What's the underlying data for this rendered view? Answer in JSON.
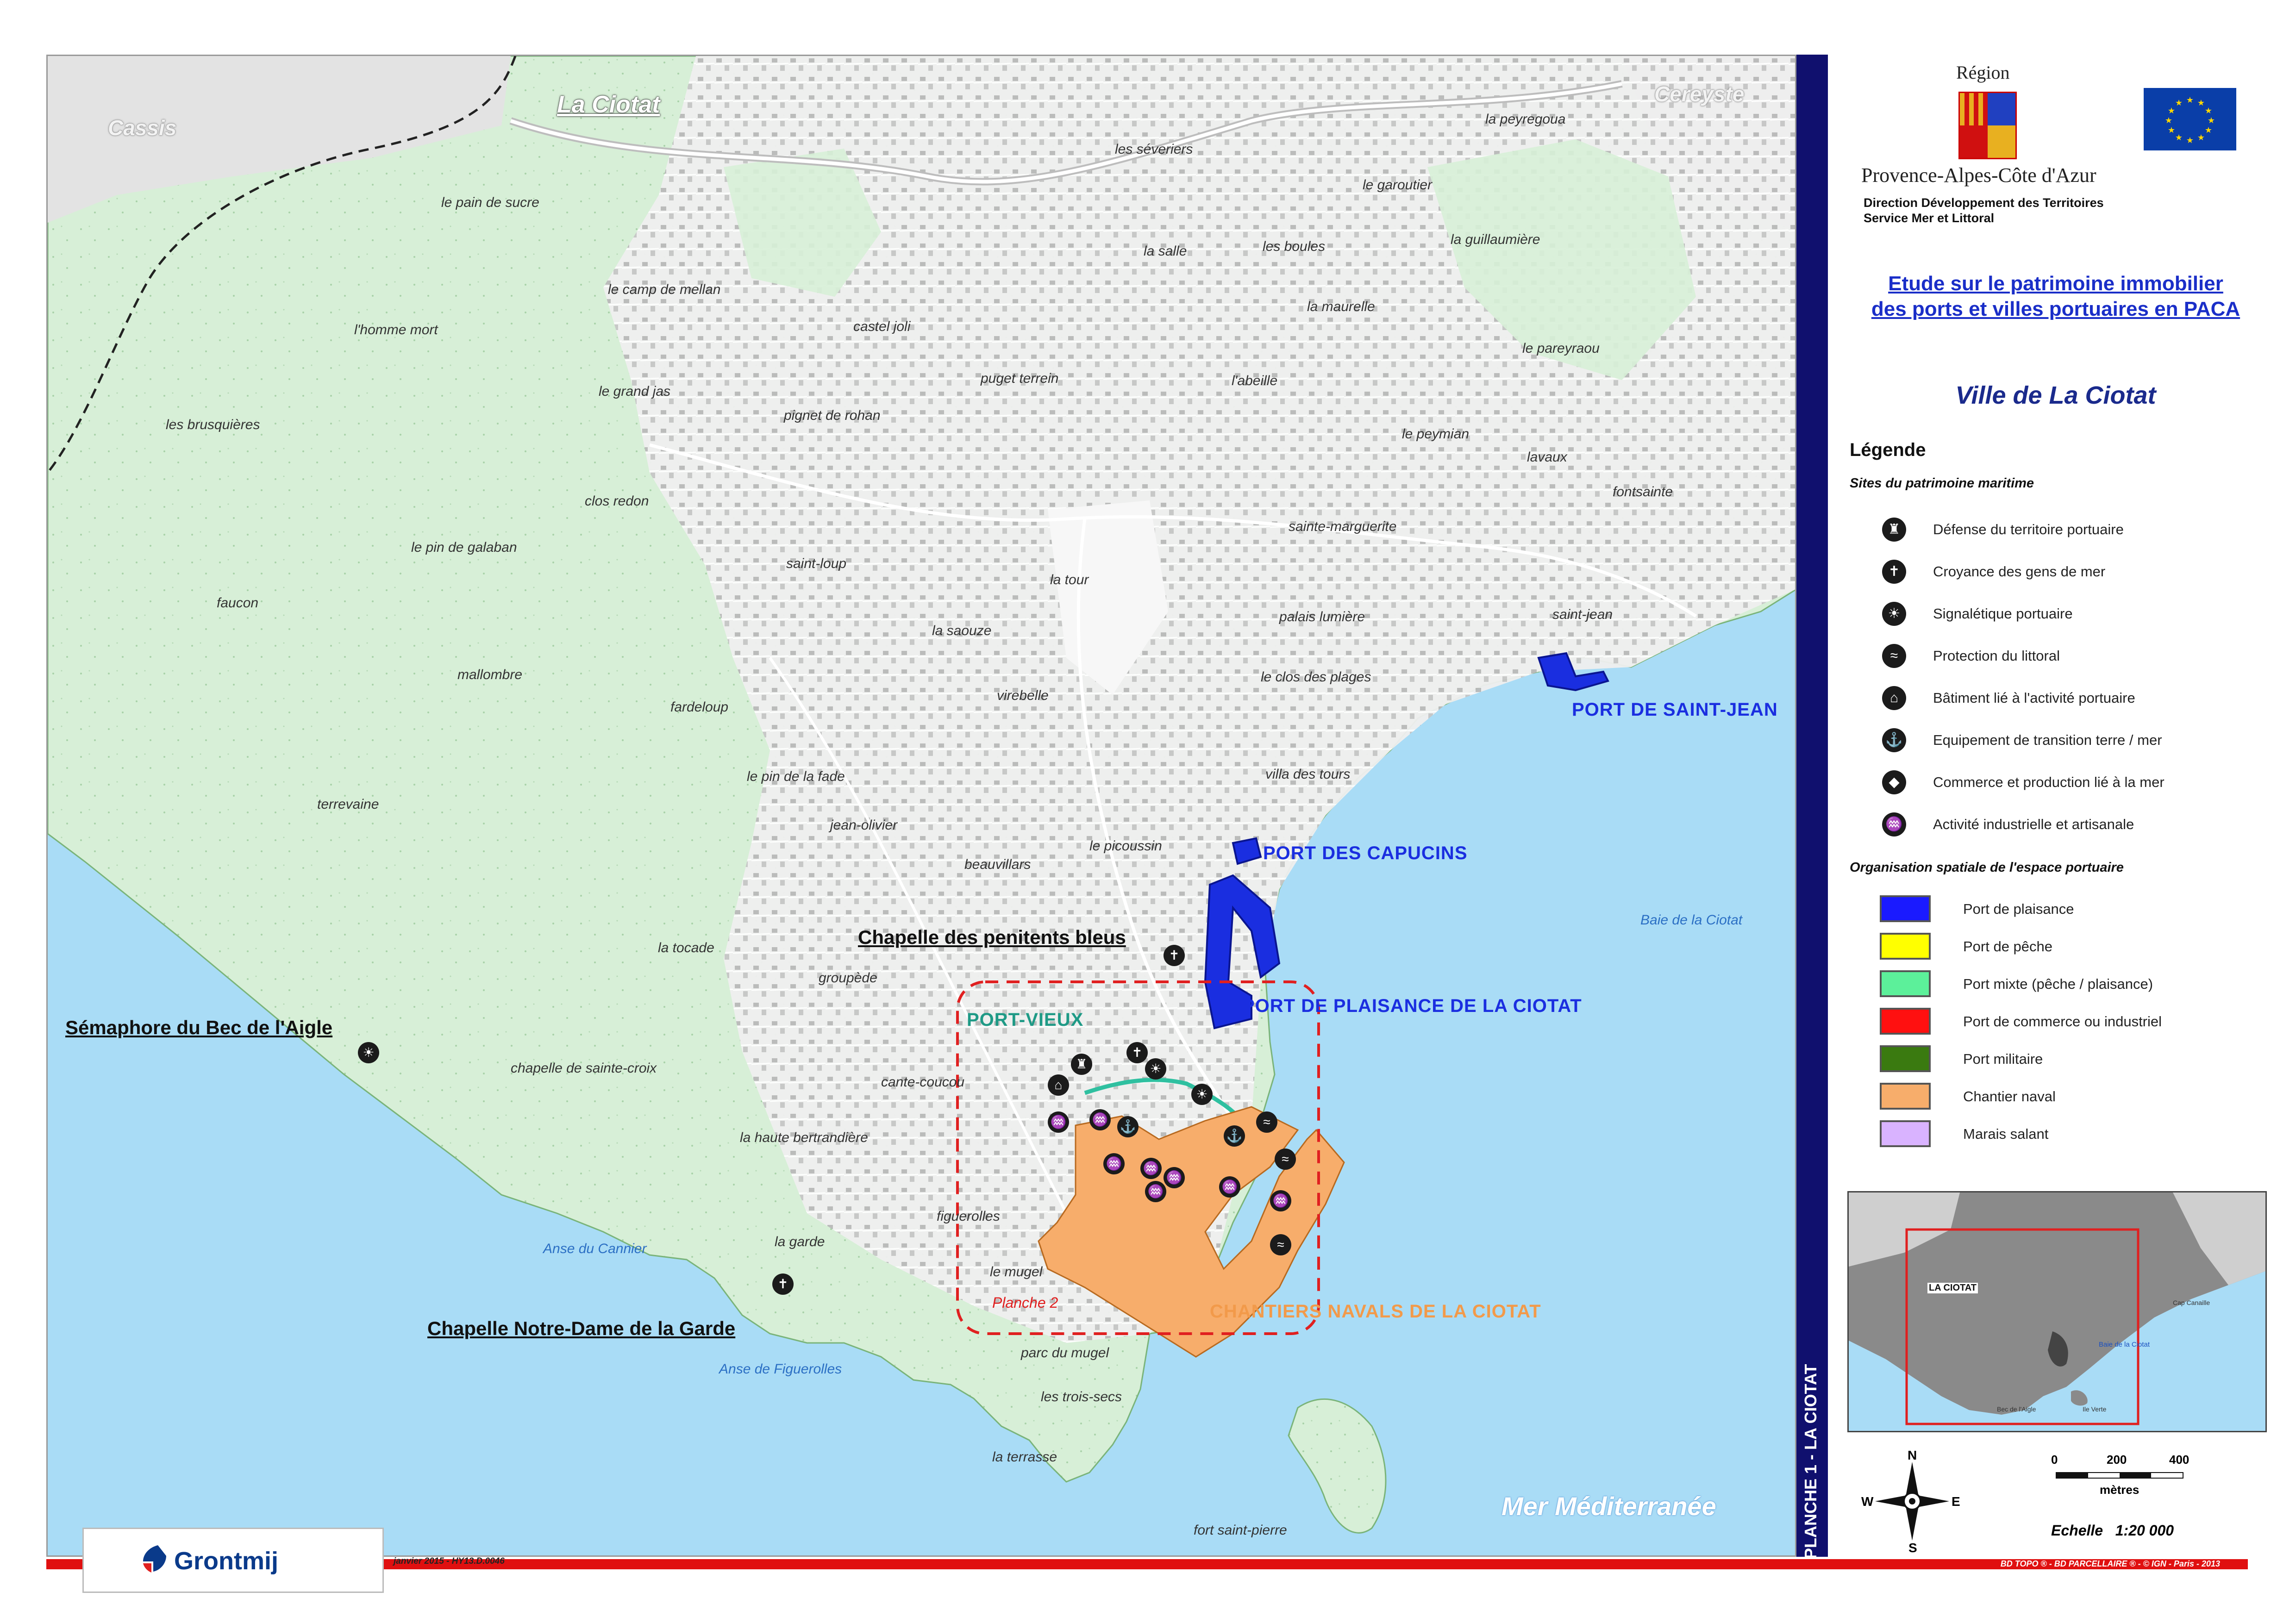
{
  "map": {
    "places": [
      {
        "id": "le-pain-de-sucre",
        "text": "le pain de sucre"
      },
      {
        "id": "le-camp-de-mellan",
        "text": "le camp de mellan"
      },
      {
        "id": "l-homme-mort",
        "text": "l'homme mort"
      },
      {
        "id": "le-grand-jas",
        "text": "le grand jas"
      },
      {
        "id": "les-brusquieres",
        "text": "les brusquières"
      },
      {
        "id": "clos-redon",
        "text": "clos redon"
      },
      {
        "id": "le-pin-de-galaban",
        "text": "le pin de galaban"
      },
      {
        "id": "faucon",
        "text": "faucon"
      },
      {
        "id": "mallombre",
        "text": "mallombre"
      },
      {
        "id": "fardeloup",
        "text": "fardeloup"
      },
      {
        "id": "terrevaine",
        "text": "terrevaine"
      },
      {
        "id": "la-tocade",
        "text": "la tocade"
      },
      {
        "id": "chapelle-de-sainte-croix",
        "text": "chapelle de sainte-croix"
      },
      {
        "id": "la-haute-bertrandiere",
        "text": "la haute bertrandière"
      },
      {
        "id": "la-garde",
        "text": "la garde"
      },
      {
        "id": "castel-joli",
        "text": "castel joli"
      },
      {
        "id": "pignet-de-rohan",
        "text": "pignet de rohan"
      },
      {
        "id": "puget-terrein",
        "text": "puget terrein"
      },
      {
        "id": "saint-loup",
        "text": "saint-loup"
      },
      {
        "id": "la-saouze",
        "text": "la saouze"
      },
      {
        "id": "la-tour",
        "text": "la tour"
      },
      {
        "id": "virebelle",
        "text": "virebelle"
      },
      {
        "id": "le-pin-de-la-fade",
        "text": "le pin de la fade"
      },
      {
        "id": "jean-olivier",
        "text": "jean-olivier"
      },
      {
        "id": "beauvillars",
        "text": "beauvillars"
      },
      {
        "id": "groupede",
        "text": "groupède"
      },
      {
        "id": "cante-coucou",
        "text": "cante-coucou"
      },
      {
        "id": "figuerolles",
        "text": "figuerolles"
      },
      {
        "id": "le-mugel",
        "text": "le mugel"
      },
      {
        "id": "parc-du-mugel",
        "text": "parc du mugel"
      },
      {
        "id": "les-trois-secs",
        "text": "les trois-secs"
      },
      {
        "id": "la-terrasse",
        "text": "la terrasse"
      },
      {
        "id": "fort-saint-pierre",
        "text": "fort saint-pierre"
      },
      {
        "id": "les-severiers",
        "text": "les séveriers"
      },
      {
        "id": "la-salle",
        "text": "la salle"
      },
      {
        "id": "les-boules",
        "text": "les boules"
      },
      {
        "id": "la-maurelle",
        "text": "la maurelle"
      },
      {
        "id": "l-abeille",
        "text": "l'abeille"
      },
      {
        "id": "le-garoutier",
        "text": "le garoutier"
      },
      {
        "id": "la-guillaumiere",
        "text": "la guillaumière"
      },
      {
        "id": "la-peyregoua",
        "text": "la peyregoua"
      },
      {
        "id": "le-pareyraou",
        "text": "le pareyraou"
      },
      {
        "id": "le-peymian",
        "text": "le peymian"
      },
      {
        "id": "lavaux",
        "text": "lavaux"
      },
      {
        "id": "fontsainte",
        "text": "fontsainte"
      },
      {
        "id": "sainte-marguerite",
        "text": "sainte-marguerite"
      },
      {
        "id": "palais-lumiere",
        "text": "palais lumière"
      },
      {
        "id": "le-clos-des-plages",
        "text": "le clos des plages"
      },
      {
        "id": "saint-jean",
        "text": "saint-jean"
      },
      {
        "id": "villa-des-tours",
        "text": "villa des tours"
      },
      {
        "id": "le-picoussin",
        "text": "le picoussin"
      }
    ],
    "towns": {
      "cassis": "Cassis",
      "cereyste": "Cereyste",
      "la_ciotat": "La Ciotat"
    },
    "ports": {
      "saint_jean": "PORT DE SAINT-JEAN",
      "capucins": "PORT DES CAPUCINS",
      "plaisance": "PORT DE PLAISANCE DE LA CIOTAT",
      "vieux": "PORT-VIEUX",
      "chantiers": "CHANTIERS NAVALS DE LA CIOTAT"
    },
    "landmarks": {
      "penitents": "Chapelle des penitents bleus",
      "semaphore": "Sémaphore du Bec de l'Aigle",
      "notre_dame": "Chapelle Notre-Dame de la Garde"
    },
    "sea": {
      "baie": "Baie de la Ciotat",
      "cannier": "Anse du Cannier",
      "figuerolles": "Anse de Figuerolles",
      "mer": "Mer Méditerranée"
    },
    "planche2": "Planche 2",
    "colors": {
      "land": "#d8f0d8",
      "urban": "#ececec",
      "sea": "#a9dcf6",
      "plaisance": "#1a2ee0",
      "mixte": "#2fc0a0",
      "chantier": "#f7ad6b",
      "frame": "#e02020"
    }
  },
  "strip": {
    "label": "PLANCHE 1 - LA CIOTAT"
  },
  "header": {
    "region_top": "Région",
    "region_name": "Provence-Alpes-Côte d'Azur",
    "direction_1": "Direction Développement des Territoires",
    "direction_2": "Service Mer et Littoral",
    "study_1": "Etude sur le patrimoine immobilier",
    "study_2": "des ports et villes portuaires en PACA",
    "city": "Ville de La Ciotat"
  },
  "legend": {
    "title": "Légende",
    "section1": "Sites du patrimoine maritime",
    "sites": [
      {
        "label": "Défense du territoire portuaire",
        "icon": "fort-icon",
        "glyph": "♜"
      },
      {
        "label": "Croyance des gens de mer",
        "icon": "chapel-icon",
        "glyph": "✝"
      },
      {
        "label": "Signalétique portuaire",
        "icon": "lighthouse-icon",
        "glyph": "☀"
      },
      {
        "label": "Protection du littoral",
        "icon": "wave-icon",
        "glyph": "≈"
      },
      {
        "label": "Bâtiment lié à l'activité portuaire",
        "icon": "building-icon",
        "glyph": "⌂"
      },
      {
        "label": "Equipement de transition terre / mer",
        "icon": "ramp-icon",
        "glyph": "⚓"
      },
      {
        "label": "Commerce et production lié à la mer",
        "icon": "fish-icon",
        "glyph": "◆"
      },
      {
        "label": "Activité industrielle et artisanale",
        "icon": "factory-icon",
        "glyph": "♒"
      }
    ],
    "section2": "Organisation spatiale de l'espace portuaire",
    "zones": [
      {
        "label": "Port de plaisance",
        "color": "#1a1aff"
      },
      {
        "label": "Port de pêche",
        "color": "#ffff00"
      },
      {
        "label": "Port mixte (pêche / plaisance)",
        "color": "#5cf09a"
      },
      {
        "label": "Port de commerce ou industriel",
        "color": "#ff1010"
      },
      {
        "label": "Port militaire",
        "color": "#3a7a10"
      },
      {
        "label": "Chantier naval",
        "color": "#f7ad6b"
      },
      {
        "label": "Marais salant",
        "color": "#d9b3ff"
      }
    ]
  },
  "inset": {
    "la_ciotat": "LA CIOTAT",
    "baie": "Baie de la Ciotat",
    "cap": "Cap Canaille",
    "bec": "Bec de l'Aigle",
    "ile": "Ile Verte"
  },
  "scale": {
    "ticks": [
      "0",
      "200",
      "400"
    ],
    "unit": "mètres",
    "ratio": "Echelle   1:20 000"
  },
  "compass": {
    "n": "N",
    "s": "S",
    "e": "E",
    "w": "W"
  },
  "footer": {
    "logo": "Grontmij",
    "date": "janvier 2015 - HY13.D.0046",
    "credits": "BD TOPO ® - BD PARCELLAIRE ® - © IGN - Paris - 2013"
  }
}
